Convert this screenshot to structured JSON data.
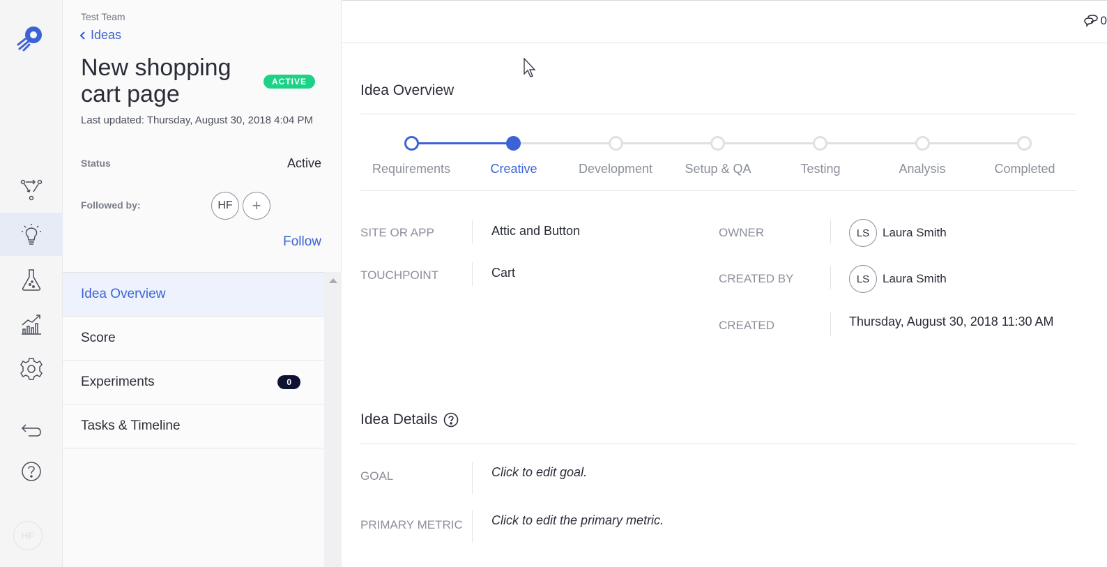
{
  "rail": {
    "icons": [
      "logo-icon",
      "workflow-icon",
      "lightbulb-icon",
      "flask-icon",
      "chart-icon",
      "gear-icon",
      "return-icon",
      "help-icon"
    ],
    "user_initials": "HF"
  },
  "panel": {
    "team": "Test Team",
    "back_label": "Ideas",
    "title": "New shopping cart page",
    "badge": "ACTIVE",
    "last_updated": "Last updated: Thursday, August 30, 2018 4:04 PM",
    "status_label": "Status",
    "status_value": "Active",
    "followed_label": "Followed by:",
    "follower_initials": "HF",
    "add_symbol": "+",
    "follow_label": "Follow",
    "menu": [
      {
        "label": "Idea Overview",
        "active": true
      },
      {
        "label": "Score"
      },
      {
        "label": "Experiments",
        "count": "0"
      },
      {
        "label": "Tasks & Timeline"
      }
    ]
  },
  "topbar": {
    "comment_count": "0"
  },
  "overview": {
    "title": "Idea Overview",
    "steps": [
      "Requirements",
      "Creative",
      "Development",
      "Setup & QA",
      "Testing",
      "Analysis",
      "Completed"
    ],
    "current_step": 1,
    "site_label": "SITE OR APP",
    "site_value": "Attic and Button",
    "touchpoint_label": "TOUCHPOINT",
    "touchpoint_value": "Cart",
    "owner_label": "OWNER",
    "owner_initials": "LS",
    "owner_name": "Laura Smith",
    "created_by_label": "CREATED BY",
    "created_by_initials": "LS",
    "created_by_name": "Laura Smith",
    "created_label": "CREATED",
    "created_value": "Thursday, August 30, 2018 11:30 AM"
  },
  "details": {
    "title": "Idea Details",
    "goal_label": "GOAL",
    "goal_placeholder": "Click to edit goal.",
    "metric_label": "PRIMARY METRIC",
    "metric_placeholder": "Click to edit the primary metric."
  },
  "colors": {
    "accent": "#3b63d6",
    "badge": "#1dd287",
    "count_bg": "#0e1233",
    "inactive_step": "#e0e0e3"
  }
}
